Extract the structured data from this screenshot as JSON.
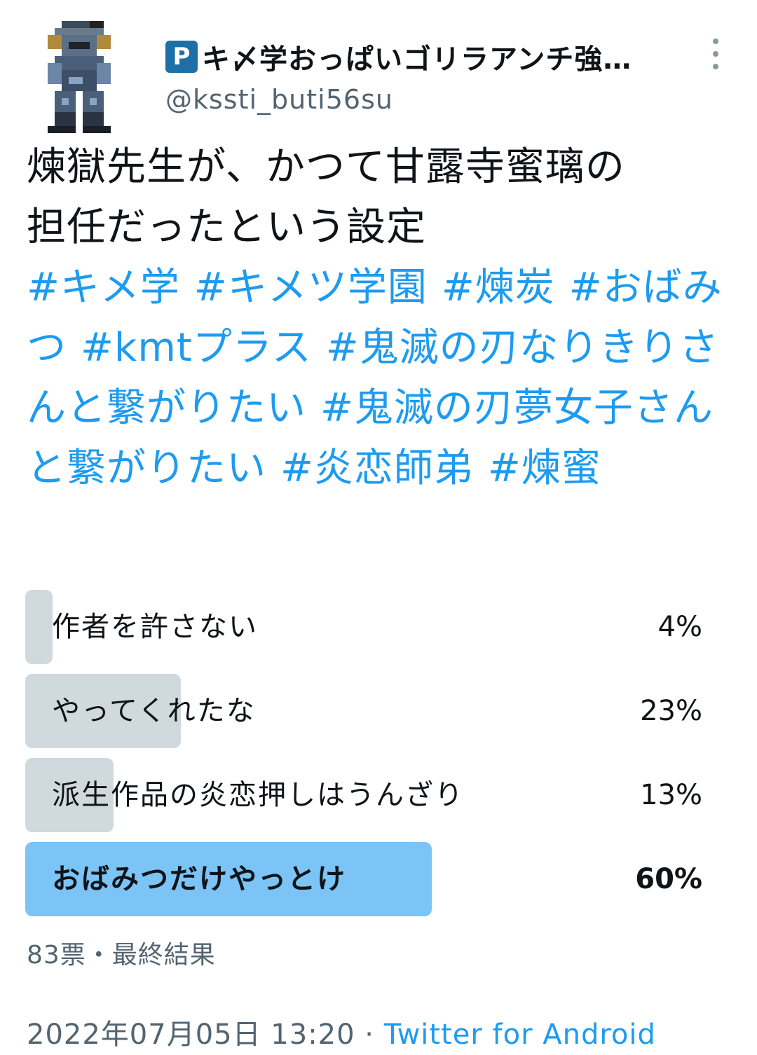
{
  "account": {
    "badge": "P",
    "display_name": "キ〆学おっぱいゴリラアンチ強…",
    "handle": "@kssti_buti56su"
  },
  "tweet": {
    "text_lines": [
      "煉獄先生が、かつて甘露寺蜜璃の",
      "担任だったという設定"
    ],
    "hashtags": [
      "#キメ学",
      "#キメツ学園",
      "#煉炭",
      "#おばみつ",
      "#kmtプラス",
      "#鬼滅の刃なりきりさんと繋がりたい",
      "#鬼滅の刃夢女子さんと繋がりたい",
      "#炎恋師弟",
      "#煉蜜"
    ]
  },
  "poll": {
    "options": [
      {
        "label": "作者を許さない",
        "percent": "4%",
        "value": 4
      },
      {
        "label": "やってくれたな",
        "percent": "23%",
        "value": 23
      },
      {
        "label": "派生作品の炎恋押しはうんざり",
        "percent": "13%",
        "value": 13
      },
      {
        "label": "おばみつだけやっとけ",
        "percent": "60%",
        "value": 60
      }
    ],
    "meta": "83票・最終結果"
  },
  "footer": {
    "timestamp": "2022年07月05日 13:20",
    "separator": " · ",
    "source": "Twitter for Android"
  },
  "colors": {
    "link": "#1d9bf0",
    "poll_bar": "#cfd9de",
    "poll_bar_winner": "#7cc4f5",
    "secondary_text": "#536471"
  }
}
